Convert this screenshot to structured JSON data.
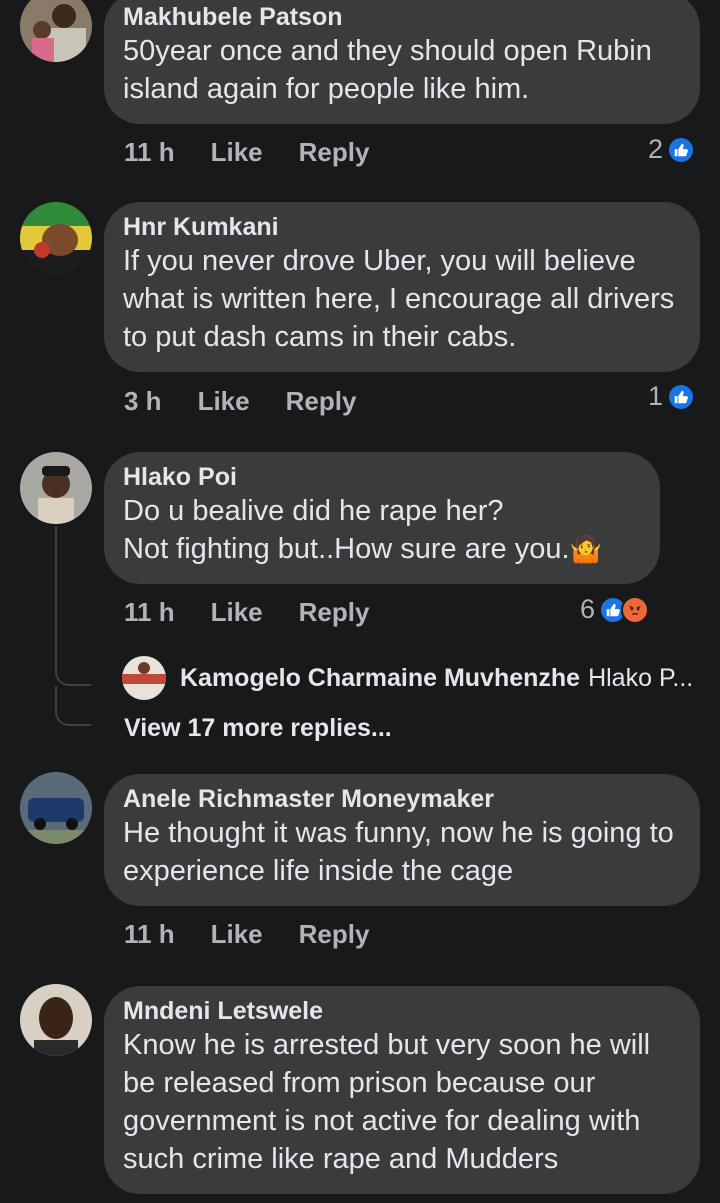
{
  "colors": {
    "background": "#18191a",
    "bubble": "#3a3b3c",
    "primary_text": "#e4e6eb",
    "secondary_text": "#b0b3b8",
    "like_blue": "#1b74e4",
    "angry_orange": "#f0673c"
  },
  "comments": [
    {
      "author": "Makhubele Patson",
      "text": "50year once and they should open Rubin island again for people like him.",
      "time": "11 h",
      "like_label": "Like",
      "reply_label": "Reply",
      "reaction_count": "2",
      "reactions": [
        "like-icon"
      ]
    },
    {
      "author": "Hnr Kumkani",
      "text": "If you never drove Uber, you will believe what is written here, I encourage all drivers to put dash cams in their cabs.",
      "time": "3 h",
      "like_label": "Like",
      "reply_label": "Reply",
      "reaction_count": "1",
      "reactions": [
        "like-icon"
      ]
    },
    {
      "author": "Hlako Poi",
      "text": "Do u bealive did he rape her?\nNot fighting but..How sure are you.",
      "emoji": "🤷",
      "time": "11 h",
      "like_label": "Like",
      "reply_label": "Reply",
      "reaction_count": "6",
      "reactions": [
        "like-icon",
        "angry-icon"
      ],
      "reply_preview": {
        "author": "Kamogelo Charmaine Muvhenzhe",
        "snippet": "Hlako P..."
      },
      "more_replies": "View 17 more replies..."
    },
    {
      "author": "Anele Richmaster Moneymaker",
      "text": "He thought it was funny, now he is going to experience life inside the cage",
      "time": "11 h",
      "like_label": "Like",
      "reply_label": "Reply"
    },
    {
      "author": "Mndeni Letswele",
      "text": "Know he is arrested but very soon he will be released from prison because our government is not active for dealing with such crime like rape and Mudders"
    }
  ]
}
